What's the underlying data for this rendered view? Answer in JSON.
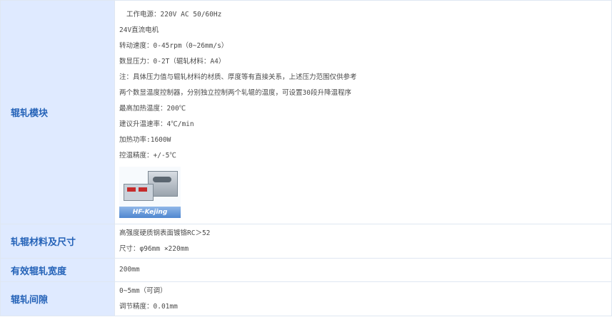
{
  "rows": [
    {
      "label": "辊轧模块",
      "lines": [
        "工作电源：220V AC 50/60Hz",
        "24V直流电机",
        "转动速度：0-45rpm（0~26mm/s）",
        "数显压力：0-2T（辊轧材料：A4）",
        "注：具体压力值与辊轧材料的材质、厚度等有直接关系，上述压力范围仅供参考",
        "两个数显温度控制器，分别独立控制两个轧辊的温度，可设置30段升降温程序",
        "最高加热温度：200℃",
        "建议升温速率：4℃/min",
        "加热功率:1600W",
        "控温精度：+/-5℃"
      ],
      "image_logo": "HF-Kejing"
    },
    {
      "label": "轧辊材料及尺寸",
      "lines": [
        "高强度硬质钢表面镀铬RC＞52",
        "尺寸：φ96mm ×220mm"
      ]
    },
    {
      "label": "有效辊轧宽度",
      "lines": [
        "200mm"
      ]
    },
    {
      "label": "辊轧间隙",
      "lines": [
        "0~5mm（可调）",
        "调节精度：0.01mm"
      ]
    }
  ]
}
